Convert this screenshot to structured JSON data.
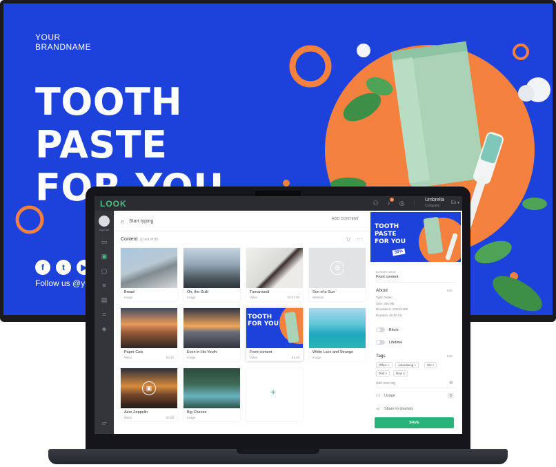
{
  "tv": {
    "brand_line1": "YOUR",
    "brand_line2": "BRANDNAME",
    "headline_line1": "TOOTH",
    "headline_line2": "PASTE",
    "headline_line3": "FOR YOU",
    "follow_text": "Follow us @yo",
    "social": [
      {
        "icon": "facebook-icon",
        "glyph": "f"
      },
      {
        "icon": "twitter-icon",
        "glyph": "t"
      },
      {
        "icon": "youtube-icon",
        "glyph": "▶"
      }
    ]
  },
  "app": {
    "logo": "LOOK",
    "user": {
      "name": "Umbrella",
      "company": "Company"
    },
    "lang": "En ▾",
    "notification_count": "1",
    "sidebar": {
      "sign_out": "Sign out"
    },
    "search": {
      "placeholder": "Start typing"
    },
    "add_content_label": "ADD CONTENT",
    "content": {
      "title": "Content",
      "count": "10 out of 89"
    },
    "cards": [
      {
        "title": "Bread",
        "type": "Image",
        "duration": ""
      },
      {
        "title": "Oh, the Guilt",
        "type": "Image",
        "duration": ""
      },
      {
        "title": "Turnaround",
        "type": "Video",
        "duration": "00:01:00"
      },
      {
        "title": "Son of a Gun",
        "type": "Website",
        "duration": ""
      },
      {
        "title": "Paper Cuts",
        "type": "Video",
        "duration": "04:30"
      },
      {
        "title": "Even in His Youth",
        "type": "Image",
        "duration": ""
      },
      {
        "title": "Front content",
        "type": "Video",
        "duration": "02:48"
      },
      {
        "title": "White Lace and Strange",
        "type": "Image",
        "duration": ""
      },
      {
        "title": "Aero Zeppelin",
        "type": "Video",
        "duration": "02:00"
      },
      {
        "title": "Big Cheese",
        "type": "Image",
        "duration": ""
      }
    ],
    "add_card_symbol": "+",
    "panel": {
      "preview_text_line1": "TOOTH",
      "preview_text_line2": "PASTE",
      "preview_text_line3": "FOR YOU",
      "preview_badge": "50%",
      "content_name_label": "Content name",
      "content_name_value": "Front content",
      "about_title": "About",
      "about_edit": "Edit",
      "about_type": "Type: Video",
      "about_size": "Size: 345 Mb",
      "about_resolution": "Resolution: 1920×1080",
      "about_duration": "Duration: 00:00:28",
      "block_label": "Block",
      "lifetime_label": "Lifetime",
      "tags_title": "Tags",
      "tags_edit": "Edit",
      "tags": [
        "Office ×",
        "Advertising ×",
        "HD ×",
        "Test ×",
        "New ×"
      ],
      "add_tag_placeholder": "Add new tag",
      "usage_label": "Usage",
      "usage_count": "5",
      "share_label": "Share to playlists",
      "save_label": "SAVE"
    }
  },
  "colors": {
    "tv_bg": "#1d42dc",
    "accent_orange": "#f5813f",
    "app_green": "#29b37a",
    "logo_green": "#4fbe83"
  }
}
